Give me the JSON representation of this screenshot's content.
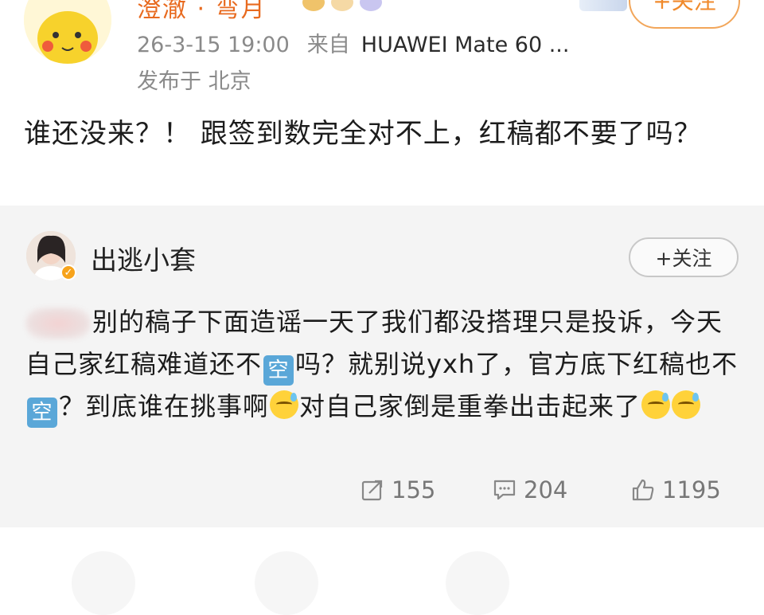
{
  "post": {
    "username": "澄澈 · 弯月",
    "follow_label": "+关注",
    "timestamp": "26-3-15 19:00",
    "source_prefix": "来自",
    "device": "HUAWEI Mate 60 ...",
    "location": "发布于 北京",
    "text": "谁还没来？！ 跟签到数完全对不上，红稿都不要了吗？"
  },
  "repost": {
    "username": "出逃小套",
    "follow_label": "+关注",
    "text_part1": "别的稿子下面造谣一天了我们都没搭理只是投诉，今天自己家红稿难道还不",
    "emoji_kong": "空",
    "text_part2": "吗？就别说yxh了，官方底下红稿也不",
    "text_part3": "？到底谁在挑事啊",
    "text_part4": "对自己家倒是重拳出击起来了",
    "stats": {
      "reposts": "155",
      "comments": "204",
      "likes": "1195"
    }
  },
  "icons": {
    "repost": "share-icon",
    "comment": "comment-icon",
    "like": "thumbs-up-icon",
    "verified": "verified-badge-icon",
    "sweat": "sweat-smile-emoji"
  },
  "colors": {
    "username_orange": "#e86a1f",
    "follow_orange": "#f08a2c",
    "repost_bg": "#f4f4f4",
    "meta_gray": "#8a8a8a"
  }
}
